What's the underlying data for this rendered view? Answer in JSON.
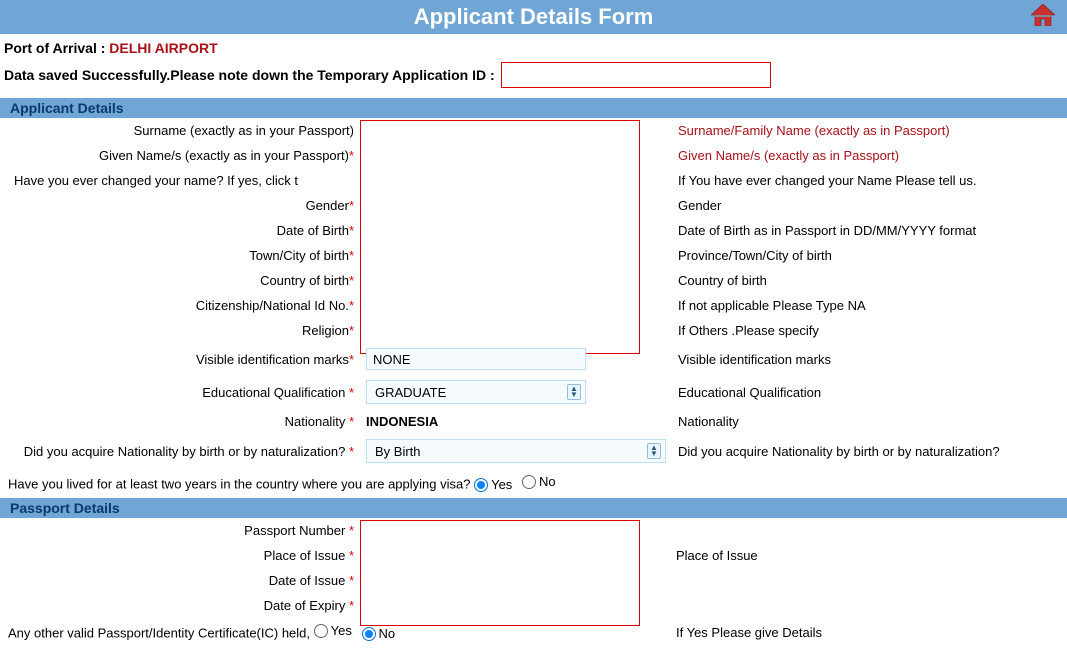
{
  "header": {
    "title": "Applicant Details Form"
  },
  "port": {
    "label": "Port of Arrival : ",
    "value": "DELHI AIRPORT"
  },
  "saved_msg": "Data saved Successfully.Please note down the Temporary Application ID :",
  "sections": {
    "applicant": "Applicant Details",
    "passport": "Passport Details"
  },
  "fields": {
    "surname": {
      "label": "Surname (exactly as in your Passport)",
      "help": "Surname/Family Name (exactly as in Passport)"
    },
    "given": {
      "label": "Given Name/s (exactly as in your Passport)",
      "req": "*",
      "help": "Given Name/s (exactly as in Passport)"
    },
    "changed": {
      "label": "Have you ever changed your name? If yes, click t",
      "help": "If You have ever changed your Name Please tell us."
    },
    "gender": {
      "label": "Gender",
      "req": "*",
      "help": "Gender"
    },
    "dob": {
      "label": "Date of Birth",
      "req": "*",
      "help": "Date of Birth as in Passport in DD/MM/YYYY format"
    },
    "town": {
      "label": "Town/City of birth",
      "req": "*",
      "help": "Province/Town/City of birth"
    },
    "cob": {
      "label": "Country of birth",
      "req": "*",
      "help": "Country of birth"
    },
    "citizen": {
      "label": "Citizenship/National Id No.",
      "req": "*",
      "help": "If not applicable Please Type NA"
    },
    "religion": {
      "label": "Religion",
      "req": "*",
      "help": "If Others .Please specify"
    },
    "marks": {
      "label": "Visible identification marks",
      "req": "*",
      "value": "NONE",
      "help": "Visible identification marks"
    },
    "edu": {
      "label": "Educational Qualification ",
      "req": "*",
      "value": "GRADUATE",
      "help": "Educational Qualification"
    },
    "nat": {
      "label": "Nationality ",
      "req": "*",
      "value": "INDONESIA",
      "help": "Nationality"
    },
    "acq": {
      "label": "Did you acquire Nationality by birth or by naturalization? ",
      "req": "*",
      "value": "By Birth",
      "help": "Did you acquire Nationality by birth or by naturalization?"
    },
    "lived": {
      "label": "Have you lived for at least two years in the country where you are applying visa?",
      "yes": "Yes",
      "no": "No"
    },
    "pnum": {
      "label": "Passport Number ",
      "req": "*"
    },
    "pplace": {
      "label": "Place of Issue ",
      "req": "*",
      "help": "Place of Issue"
    },
    "pissue": {
      "label": "Date of Issue ",
      "req": "*"
    },
    "pexpiry": {
      "label": "Date of Expiry ",
      "req": "*"
    },
    "other_pp": {
      "label": "Any other valid Passport/Identity Certificate(IC) held,",
      "yes": "Yes",
      "no": "No",
      "help": "If Yes Please give Details"
    }
  }
}
